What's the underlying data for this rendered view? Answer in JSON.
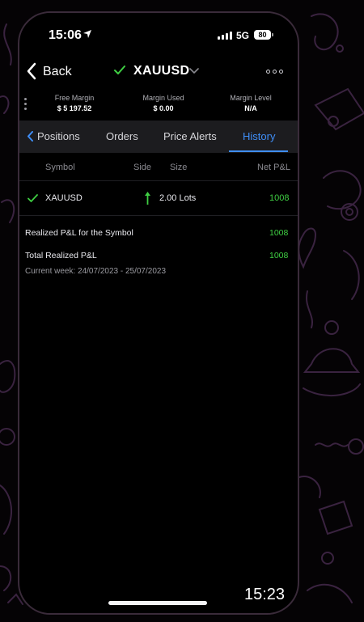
{
  "status_bar": {
    "time": "15:06",
    "network": "5G",
    "battery": "80"
  },
  "nav": {
    "back_label": "Back",
    "title": "XAUUSD"
  },
  "margin": {
    "free_margin_label": "Free Margin",
    "free_margin_value": "$ 5 197.52",
    "margin_used_label": "Margin Used",
    "margin_used_value": "$ 0.00",
    "margin_level_label": "Margin Level",
    "margin_level_value": "N/A"
  },
  "tabs": [
    {
      "label": "Positions"
    },
    {
      "label": "Orders"
    },
    {
      "label": "Price Alerts"
    },
    {
      "label": "History"
    }
  ],
  "table": {
    "headers": {
      "symbol": "Symbol",
      "side": "Side",
      "size": "Size",
      "net_pl": "Net P&L"
    },
    "rows": [
      {
        "symbol": "XAUUSD",
        "size": "2.00 Lots",
        "net_pl": "1008"
      }
    ]
  },
  "summary": {
    "realized_symbol_label": "Realized P&L for the Symbol",
    "realized_symbol_value": "1008",
    "total_realized_label": "Total Realized P&L",
    "total_realized_value": "1008",
    "week_label": "Current week: 24/07/2023 - 25/07/2023"
  },
  "overlay_time": "15:23",
  "colors": {
    "accent": "#3f8ef7",
    "positive": "#3fcf43",
    "background": "#000000",
    "tab_bar": "#1c1c1f"
  }
}
